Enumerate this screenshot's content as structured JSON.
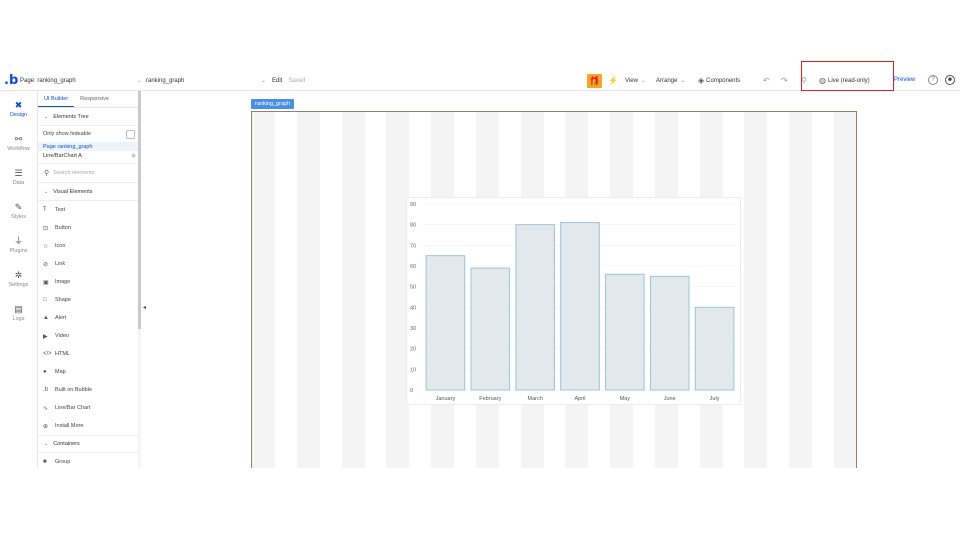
{
  "topbar": {
    "page_prefix": "Page: ranking_graph",
    "page_name": "ranking_graph",
    "edit_label": "Edit",
    "saved_label": "Saved",
    "view_label": "View",
    "arrange_label": "Arrange",
    "components_label": "Components",
    "live_label": "Live (read-only)",
    "preview_label": "Preview"
  },
  "rail": {
    "items": [
      {
        "label": "Design",
        "icon": "design-icon"
      },
      {
        "label": "Workflow",
        "icon": "workflow-icon"
      },
      {
        "label": "Data",
        "icon": "data-icon"
      },
      {
        "label": "Styles",
        "icon": "styles-icon"
      },
      {
        "label": "Plugins",
        "icon": "plugins-icon"
      },
      {
        "label": "Settings",
        "icon": "settings-icon"
      },
      {
        "label": "Logs",
        "icon": "logs-icon"
      }
    ]
  },
  "panel": {
    "tabs": [
      "UI Builder",
      "Responsive"
    ],
    "elements_tree_label": "Elements Tree",
    "only_show_hideable": "Only show hideable",
    "tree_selected": "Page ranking_graph",
    "tree_child": "Line/BarChart A",
    "search_placeholder": "Search elements",
    "visual_elements_label": "Visual Elements",
    "visual_items": [
      "Text",
      "Button",
      "Icon",
      "Link",
      "Image",
      "Shape",
      "Alert",
      "Video",
      "HTML",
      "Map",
      "Built on Bubble",
      "Line/Bar Chart",
      "Install More"
    ],
    "containers_label": "Containers",
    "container_items": [
      "Group"
    ]
  },
  "canvas": {
    "page_tag": "ranking_graph"
  },
  "colors": {
    "accent": "#0b4fd1",
    "highlight_box": "#e02020",
    "gift": "#f5a623",
    "bar_fill": "#e2e8ec",
    "bar_stroke": "#9ec3d8"
  },
  "chart_data": {
    "type": "bar",
    "categories": [
      "January",
      "February",
      "March",
      "April",
      "May",
      "June",
      "July"
    ],
    "values": [
      65,
      59,
      80,
      81,
      56,
      55,
      40
    ],
    "ylim": [
      0,
      90
    ],
    "yticks": [
      "0",
      "10",
      "20",
      "30",
      "40",
      "50",
      "60",
      "70",
      "80",
      "90"
    ],
    "grid": true
  }
}
